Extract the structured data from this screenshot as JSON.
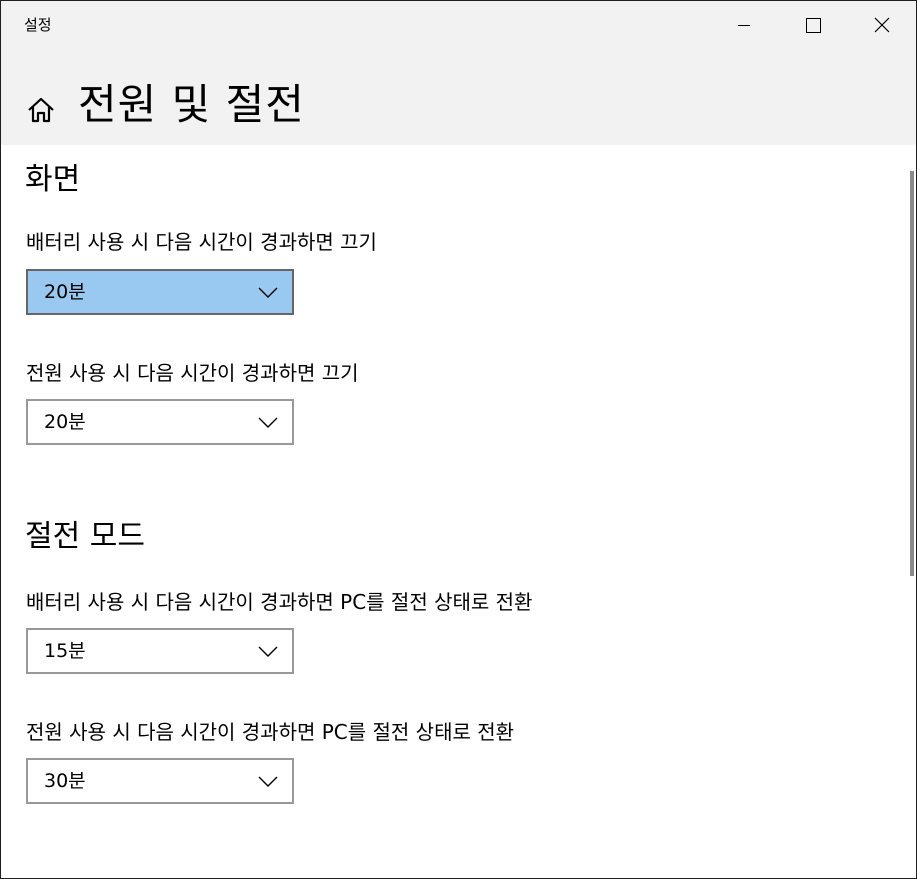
{
  "window": {
    "app_title": "설정",
    "controls": {
      "minimize_icon": "minimize-icon",
      "maximize_icon": "maximize-icon",
      "close_icon": "close-icon"
    }
  },
  "header": {
    "home_icon": "home-icon",
    "title": "전원 및 절전"
  },
  "sections": {
    "screen": {
      "title": "화면",
      "battery_label": "배터리 사용 시 다음 시간이 경과하면 끄기",
      "battery_value": "20분",
      "power_label": "전원 사용 시 다음 시간이 경과하면 끄기",
      "power_value": "20분"
    },
    "sleep": {
      "title": "절전 모드",
      "battery_label": "배터리 사용 시 다음 시간이 경과하면 PC를 절전 상태로 전환",
      "battery_value": "15분",
      "power_label": "전원 사용 시 다음 시간이 경과하면 PC를 절전 상태로 전환",
      "power_value": "30분"
    }
  },
  "colors": {
    "titlebar_bg": "#f2f2f2",
    "focused_dropdown_bg": "#99c9f0",
    "dropdown_border": "#999999"
  }
}
